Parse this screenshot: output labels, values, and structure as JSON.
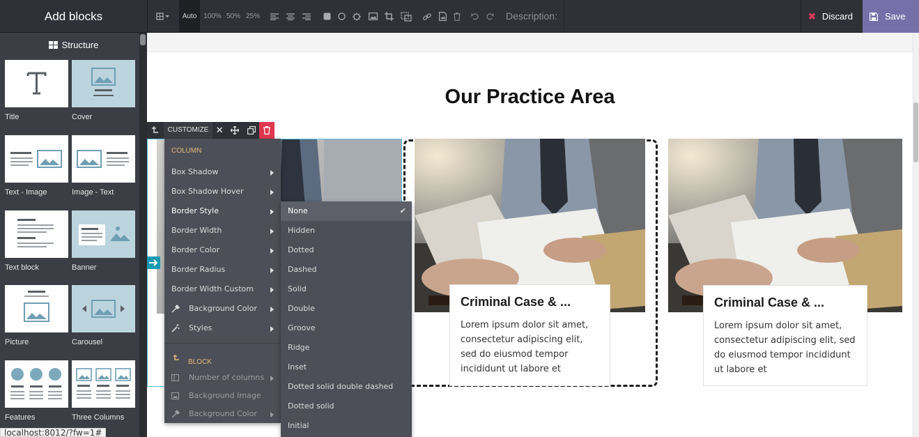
{
  "topbar": {
    "title": "Add blocks",
    "zoom_auto": "Auto",
    "zoom_100": "100%",
    "zoom_50": "50%",
    "zoom_25": "25%",
    "description_label": "Description:",
    "discard_label": "Discard",
    "save_label": "Save",
    "accent": "#7670a8"
  },
  "sidebar": {
    "heading": "Structure",
    "blocks": [
      {
        "label": "Title"
      },
      {
        "label": "Cover"
      },
      {
        "label": "Text - Image"
      },
      {
        "label": "Image - Text"
      },
      {
        "label": "Text block"
      },
      {
        "label": "Banner"
      },
      {
        "label": "Picture"
      },
      {
        "label": "Carousel"
      },
      {
        "label": "Features"
      },
      {
        "label": "Three Columns"
      }
    ]
  },
  "status_url": "localhost:8012/?fw=1#",
  "page": {
    "heading": "Our Practice Area",
    "cards": [
      {
        "title": "Criminal Case & ...",
        "body": "Lorem ipsum dolor sit amet, consectetur adipiscing elit, sed do eiusmod tempor incididunt ut labore et"
      },
      {
        "title": "Criminal Case & ...",
        "body": "Lorem ipsum dolor sit amet, consectetur adipiscing elit, sed do eiusmod tempor incididunt ut labore et"
      }
    ]
  },
  "customize_bar": {
    "label": "CUSTOMIZE"
  },
  "menu": {
    "column_heading": "COLUMN",
    "items": [
      {
        "label": "Box Shadow"
      },
      {
        "label": "Box Shadow Hover"
      },
      {
        "label": "Border Style"
      },
      {
        "label": "Border Width"
      },
      {
        "label": "Border Color"
      },
      {
        "label": "Border Radius"
      },
      {
        "label": "Border Width Custom"
      },
      {
        "label": "Background Color"
      },
      {
        "label": "Styles"
      }
    ],
    "block_heading": "BLOCK",
    "block_items": [
      {
        "label": "Number of columns"
      },
      {
        "label": "Background Image"
      },
      {
        "label": "Background Color"
      }
    ]
  },
  "submenu": {
    "selected": "None",
    "items": [
      {
        "label": "None"
      },
      {
        "label": "Hidden"
      },
      {
        "label": "Dotted"
      },
      {
        "label": "Dashed"
      },
      {
        "label": "Solid"
      },
      {
        "label": "Double"
      },
      {
        "label": "Groove"
      },
      {
        "label": "Ridge"
      },
      {
        "label": "Inset"
      },
      {
        "label": "Dotted solid double dashed"
      },
      {
        "label": "Dotted solid"
      },
      {
        "label": "Initial"
      }
    ]
  }
}
